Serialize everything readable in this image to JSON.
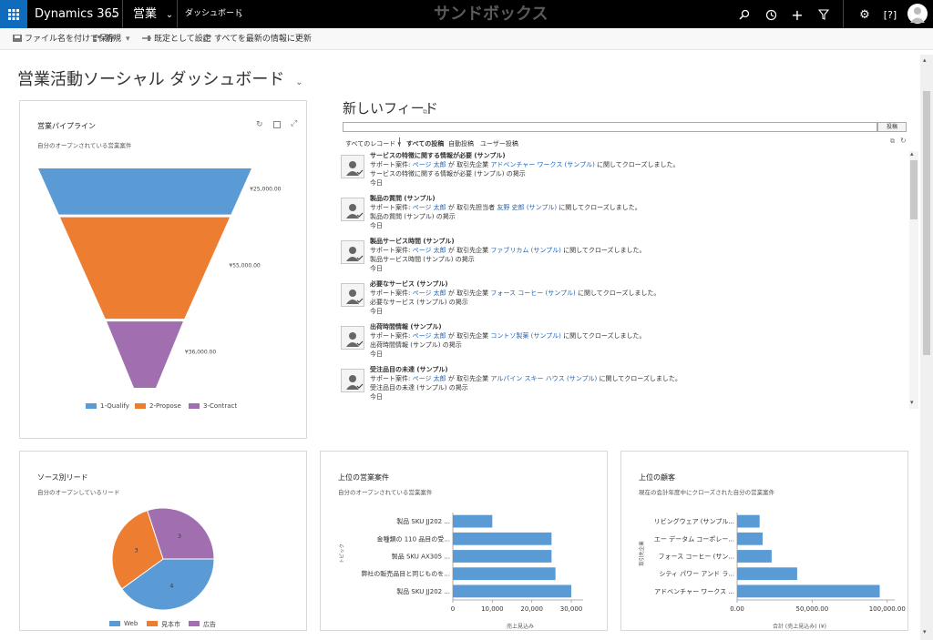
{
  "topbar": {
    "app": "Dynamics 365",
    "module": "営業",
    "area": "ダッシュボード",
    "sandbox": "サンドボックス"
  },
  "commands": {
    "save_as": "ファイル名を付けて保存",
    "new": "新規",
    "set_default": "既定として設定",
    "refresh_all": "すべてを最新の情報に更新"
  },
  "page": {
    "title": "営業活動ソーシャル ダッシュボード"
  },
  "pipeline": {
    "title": "営業パイプライン",
    "subtitle": "自分のオープンされている営業案件",
    "labels": [
      "¥25,000.00",
      "¥55,000.00",
      "¥36,000.00"
    ],
    "legend": [
      "1-Qualify",
      "2-Propose",
      "3-Contract"
    ],
    "colors": [
      "#5b9bd5",
      "#ed7d31",
      "#a16fb0"
    ]
  },
  "feed": {
    "title": "新しいフィード",
    "post_button": "投稿",
    "filter_all_records": "すべてのレコード",
    "filters": [
      "すべての投稿",
      "自動投稿",
      "ユーザー投稿"
    ],
    "items": [
      {
        "title": "サービスの特徴に関する情報が必要 (サンプル)",
        "prefix": "サポート案件:",
        "user": "ページ 太郎",
        "mid": "が 取引先企業",
        "account": "アドベンチャー ワークス (サンプル)",
        "suffix": "に関してクローズしました。",
        "line3": "サービスの特徴に関する情報が必要 (サンプル) の掲示",
        "when": "今日"
      },
      {
        "title": "製品の質問 (サンプル)",
        "prefix": "サポート案件:",
        "user": "ページ 太郎",
        "mid": "が 取引先担当者",
        "account": "友野 史郎 (サンプル)",
        "suffix": "に関してクローズしました。",
        "line3": "製品の質問 (サンプル) の掲示",
        "when": "今日"
      },
      {
        "title": "製品サービス時間 (サンプル)",
        "prefix": "サポート案件:",
        "user": "ページ 太郎",
        "mid": "が 取引先企業",
        "account": "ファブリカム (サンプル)",
        "suffix": "に関してクローズしました。",
        "line3": "製品サービス時間 (サンプル) の掲示",
        "when": "今日"
      },
      {
        "title": "必要なサービス (サンプル)",
        "prefix": "サポート案件:",
        "user": "ページ 太郎",
        "mid": "が 取引先企業",
        "account": "フォース コーヒー (サンプル)",
        "suffix": "に関してクローズしました。",
        "line3": "必要なサービス (サンプル) の掲示",
        "when": "今日"
      },
      {
        "title": "出荷時間情報 (サンプル)",
        "prefix": "サポート案件:",
        "user": "ページ 太郎",
        "mid": "が 取引先企業",
        "account": "コントソ製薬 (サンプル)",
        "suffix": "に関してクローズしました。",
        "line3": "出荷時間情報 (サンプル) の掲示",
        "when": "今日"
      },
      {
        "title": "受注品目の未達 (サンプル)",
        "prefix": "サポート案件:",
        "user": "ページ 太郎",
        "mid": "が 取引先企業",
        "account": "アルパイン スキー ハウス (サンプル)",
        "suffix": "に関してクローズしました。",
        "line3": "受注品目の未達 (サンプル) の掲示",
        "when": "今日"
      }
    ]
  },
  "leads": {
    "title": "ソース別リード",
    "subtitle": "自分のオープンしているリード",
    "legend": [
      "Web",
      "見本市",
      "広告"
    ],
    "colors": [
      "#5b9bd5",
      "#ed7d31",
      "#a16fb0"
    ]
  },
  "top_opps": {
    "title": "上位の営業案件",
    "subtitle": "自分のオープンされている営業案件",
    "ylabel": "トピック",
    "xlabel": "売上見込み"
  },
  "top_customers": {
    "title": "上位の顧客",
    "subtitle": "現在の会計年度中にクローズされた自分の営業案件",
    "ylabel": "取引先企業",
    "xlabel": "合計 (売上見込み) (¥)"
  },
  "chart_data": [
    {
      "type": "funnel",
      "categories": [
        "1-Qualify",
        "2-Propose",
        "3-Contract"
      ],
      "values": [
        25000,
        55000,
        36000
      ],
      "labels": [
        "¥25,000.00",
        "¥55,000.00",
        "¥36,000.00"
      ]
    },
    {
      "type": "pie",
      "categories": [
        "Web",
        "見本市",
        "広告"
      ],
      "values": [
        4,
        3,
        3
      ]
    },
    {
      "type": "bar",
      "orientation": "horizontal",
      "categories": [
        "製品 SKU JJ202 ...",
        "金種類の 110 品目の受...",
        "製品 SKU AX305 ...",
        "弊社の販売品目と同じものを...",
        "製品 SKU JJ202 ..."
      ],
      "values": [
        10000,
        25000,
        25000,
        26000,
        30000
      ],
      "xticks": [
        "0",
        "10,000",
        "20,000",
        "30,000"
      ],
      "xlim": [
        0,
        33000
      ]
    },
    {
      "type": "bar",
      "orientation": "horizontal",
      "categories": [
        "リビングウェア (サンプル...",
        "エー データム コーポレー...",
        "フォース コーヒー (サン...",
        "シティ パワー アンド ラ...",
        "アドベンチャー ワークス ..."
      ],
      "values": [
        15000,
        17000,
        23000,
        40000,
        95000
      ],
      "xticks": [
        "0.00",
        "50,000.00",
        "100,000.00"
      ],
      "xlim": [
        0,
        105000
      ]
    }
  ]
}
